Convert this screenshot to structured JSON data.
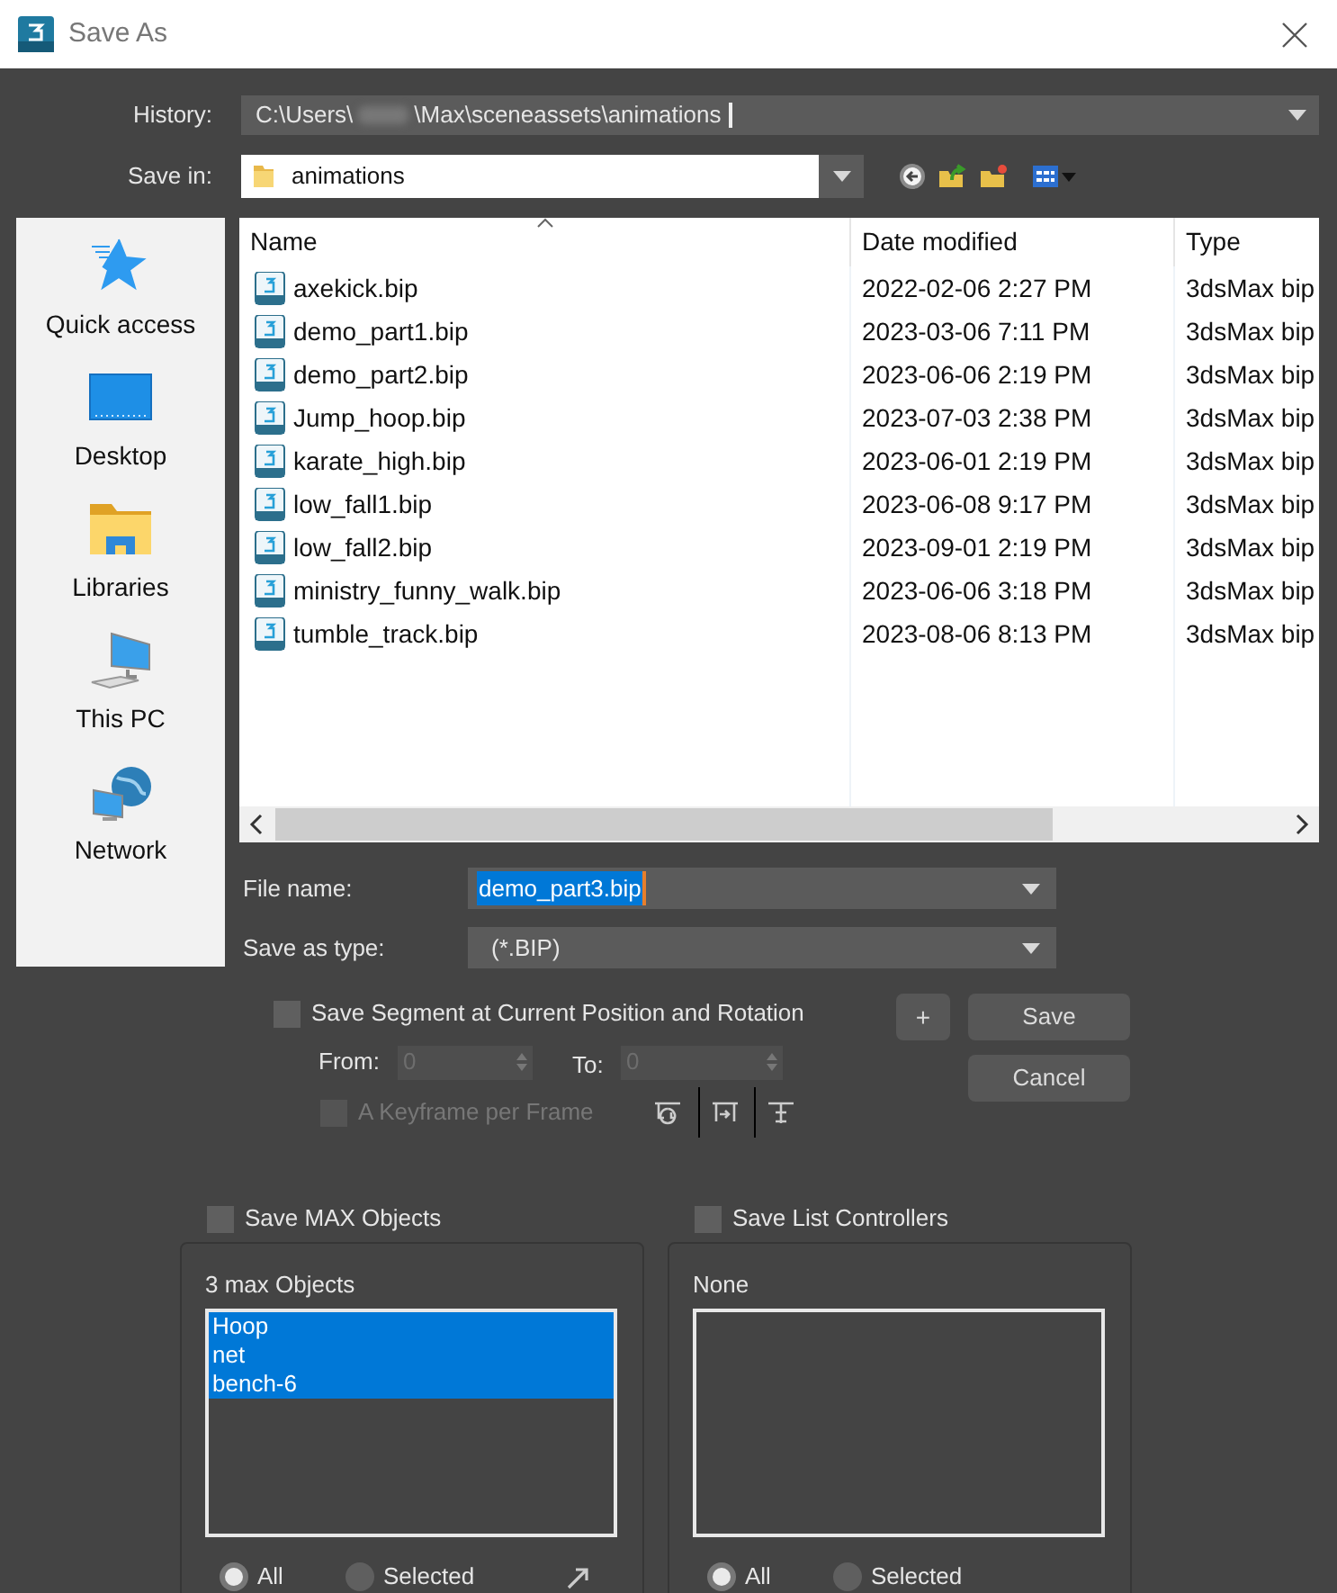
{
  "window": {
    "title": "Save As"
  },
  "history": {
    "label": "History:",
    "path_start": "C:\\Users\\",
    "path_end": "\\Max\\sceneassets\\animations"
  },
  "save_in": {
    "label": "Save in:",
    "value": "animations"
  },
  "places": [
    {
      "kind": "quick_access",
      "label": "Quick access"
    },
    {
      "kind": "desktop",
      "label": "Desktop"
    },
    {
      "kind": "libraries",
      "label": "Libraries"
    },
    {
      "kind": "pc",
      "label": "This PC"
    },
    {
      "kind": "network",
      "label": "Network"
    }
  ],
  "file_list": {
    "columns": [
      {
        "label": "Name",
        "sorted": true
      },
      {
        "label": "Date modified",
        "sorted": false
      },
      {
        "label": "Type",
        "sorted": false
      }
    ],
    "rows": [
      {
        "name": "axekick.bip",
        "date": "2022-02-06 2:27 PM",
        "type": "3dsMax bip"
      },
      {
        "name": "demo_part1.bip",
        "date": "2023-03-06 7:11 PM",
        "type": "3dsMax bip"
      },
      {
        "name": "demo_part2.bip",
        "date": "2023-06-06 2:19 PM",
        "type": "3dsMax bip"
      },
      {
        "name": "Jump_hoop.bip",
        "date": "2023-07-03 2:38 PM",
        "type": "3dsMax bip"
      },
      {
        "name": "karate_high.bip",
        "date": "2023-06-01 2:19 PM",
        "type": "3dsMax bip"
      },
      {
        "name": "low_fall1.bip",
        "date": "2023-06-08 9:17 PM",
        "type": "3dsMax bip"
      },
      {
        "name": "low_fall2.bip",
        "date": "2023-09-01 2:19 PM",
        "type": "3dsMax bip"
      },
      {
        "name": "ministry_funny_walk.bip",
        "date": "2023-06-06 3:18 PM",
        "type": "3dsMax bip"
      },
      {
        "name": "tumble_track.bip",
        "date": "2023-08-06 8:13 PM",
        "type": "3dsMax bip"
      }
    ]
  },
  "file_name": {
    "label": "File name:",
    "value": "demo_part3.bip",
    "selected": true
  },
  "save_as_type": {
    "label": "Save as type:",
    "value": "(*.BIP)"
  },
  "segment": {
    "label": "Save Segment at Current Position and Rotation",
    "checked": false,
    "from_label": "From:",
    "from_value": "0",
    "to_label": "To:",
    "to_value": "0"
  },
  "keyframe": {
    "label": "A Keyframe per Frame",
    "checked": false,
    "disabled": true
  },
  "buttons": {
    "plus": "+",
    "save": "Save",
    "cancel": "Cancel"
  },
  "groups": [
    {
      "label": "Save MAX Objects",
      "checked": false,
      "caption": "3 max Objects",
      "pick_icon": true,
      "items": [
        {
          "name": "Hoop",
          "selected": true
        },
        {
          "name": "net",
          "selected": true
        },
        {
          "name": "bench-6",
          "selected": true
        }
      ],
      "radios": [
        {
          "label": "All",
          "selected": true
        },
        {
          "label": "Selected",
          "selected": false
        }
      ]
    },
    {
      "label": "Save List Controllers",
      "checked": false,
      "caption": "None",
      "pick_icon": false,
      "radios": [
        {
          "label": "All",
          "selected": true
        },
        {
          "label": "Selected",
          "selected": false
        }
      ]
    }
  ]
}
